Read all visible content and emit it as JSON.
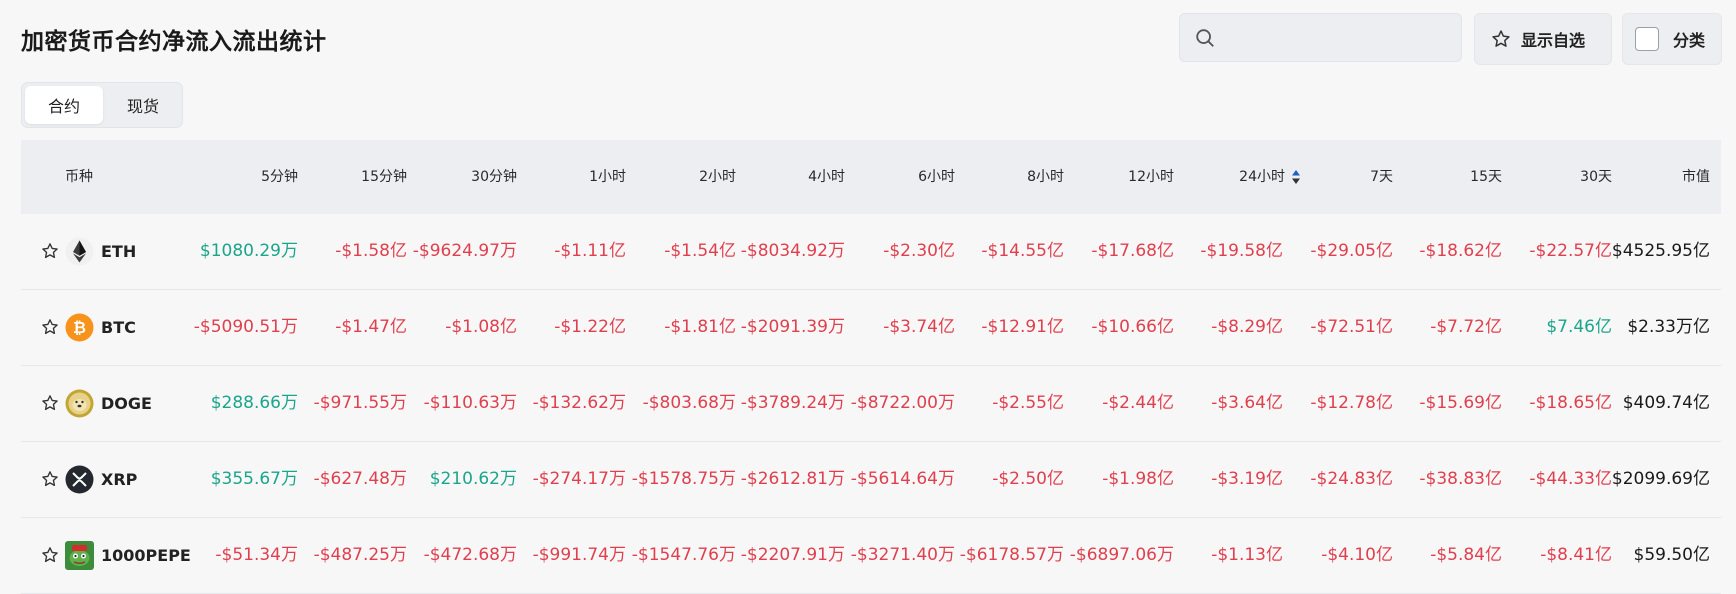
{
  "page": {
    "title": "加密货币合约净流入流出统计"
  },
  "search": {
    "placeholder": ""
  },
  "toolbar": {
    "favorites_label": "显示自选",
    "category_label": "分类"
  },
  "tabs": [
    {
      "label": "合约",
      "active": true
    },
    {
      "label": "现货",
      "active": false
    }
  ],
  "colors": {
    "positive": "#1aa68a",
    "negative": "#e0404d",
    "sort_active": "#1f5fbf"
  },
  "table": {
    "coin_header": "币种",
    "headers": [
      "5分钟",
      "15分钟",
      "30分钟",
      "1小时",
      "2小时",
      "4小时",
      "6小时",
      "8小时",
      "12小时",
      "24小时",
      "7天",
      "15天",
      "30天",
      "市值"
    ],
    "sorted_column": "24小时",
    "rows": [
      {
        "symbol": "ETH",
        "icon": "eth-icon",
        "values": [
          "$1080.29万",
          "-$1.58亿",
          "-$9624.97万",
          "-$1.11亿",
          "-$1.54亿",
          "-$8034.92万",
          "-$2.30亿",
          "-$14.55亿",
          "-$17.68亿",
          "-$19.58亿",
          "-$29.05亿",
          "-$18.62亿",
          "-$22.57亿",
          "$4525.95亿"
        ]
      },
      {
        "symbol": "BTC",
        "icon": "btc-icon",
        "values": [
          "-$5090.51万",
          "-$1.47亿",
          "-$1.08亿",
          "-$1.22亿",
          "-$1.81亿",
          "-$2091.39万",
          "-$3.74亿",
          "-$12.91亿",
          "-$10.66亿",
          "-$8.29亿",
          "-$72.51亿",
          "-$7.72亿",
          "$7.46亿",
          "$2.33万亿"
        ]
      },
      {
        "symbol": "DOGE",
        "icon": "doge-icon",
        "values": [
          "$288.66万",
          "-$971.55万",
          "-$110.63万",
          "-$132.62万",
          "-$803.68万",
          "-$3789.24万",
          "-$8722.00万",
          "-$2.55亿",
          "-$2.44亿",
          "-$3.64亿",
          "-$12.78亿",
          "-$15.69亿",
          "-$18.65亿",
          "$409.74亿"
        ]
      },
      {
        "symbol": "XRP",
        "icon": "xrp-icon",
        "values": [
          "$355.67万",
          "-$627.48万",
          "$210.62万",
          "-$274.17万",
          "-$1578.75万",
          "-$2612.81万",
          "-$5614.64万",
          "-$2.50亿",
          "-$1.98亿",
          "-$3.19亿",
          "-$24.83亿",
          "-$38.83亿",
          "-$44.33亿",
          "$2099.69亿"
        ]
      },
      {
        "symbol": "1000PEPE",
        "icon": "pepe-icon",
        "values": [
          "-$51.34万",
          "-$487.25万",
          "-$472.68万",
          "-$991.74万",
          "-$1547.76万",
          "-$2207.91万",
          "-$3271.40万",
          "-$6178.57万",
          "-$6897.06万",
          "-$1.13亿",
          "-$4.10亿",
          "-$5.84亿",
          "-$8.41亿",
          "$59.50亿"
        ]
      }
    ]
  }
}
